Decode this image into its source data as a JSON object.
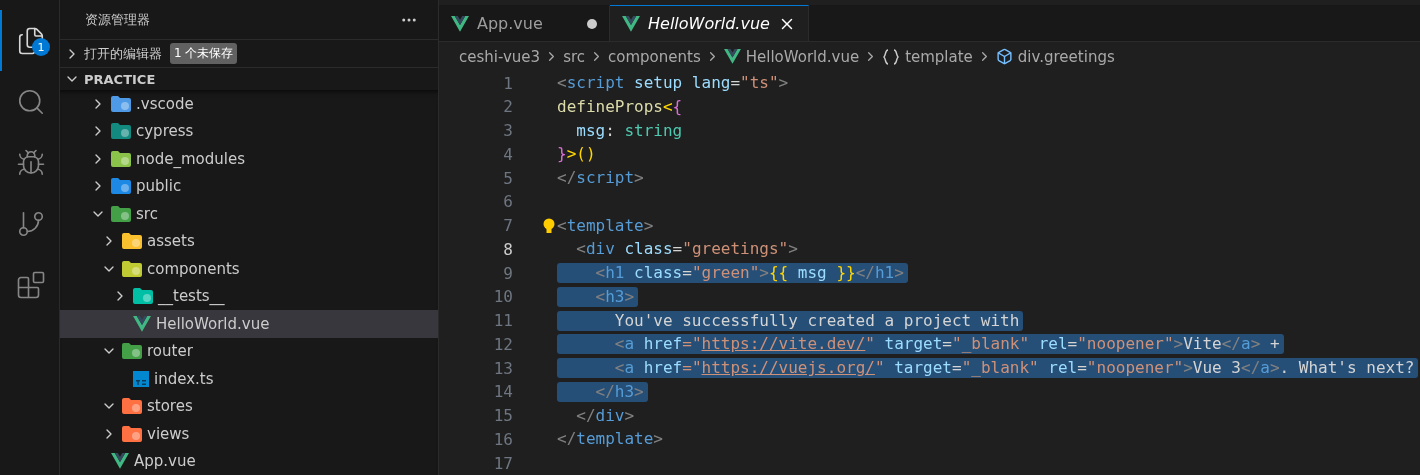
{
  "activity_bar": [
    {
      "kind": "files",
      "selected": true,
      "badge": "1"
    },
    {
      "kind": "search",
      "selected": false
    },
    {
      "kind": "debug",
      "selected": false
    },
    {
      "kind": "git",
      "selected": false
    },
    {
      "kind": "extensions",
      "selected": false
    }
  ],
  "sidebar": {
    "title": "资源管理器",
    "open_editors": {
      "label": "打开的编辑器",
      "expanded": false,
      "badge": "1 个未保存"
    },
    "project": {
      "label": "PRACTICE",
      "expanded": true,
      "tree": [
        {
          "label": ".vscode",
          "kind": "folder",
          "color": "#4f9ae6",
          "expanded": false
        },
        {
          "label": "cypress",
          "kind": "folder",
          "color": "#138a80",
          "expanded": false
        },
        {
          "label": "node_modules",
          "kind": "folder",
          "color": "#8bc34a",
          "expanded": false
        },
        {
          "label": "public",
          "kind": "folder",
          "color": "#1e88e5",
          "expanded": false
        },
        {
          "label": "src",
          "kind": "folder",
          "color": "#43a047",
          "expanded": true,
          "children": [
            {
              "label": "assets",
              "kind": "folder",
              "color": "#fbc02d",
              "expanded": false
            },
            {
              "label": "components",
              "kind": "folder",
              "color": "#c0ca33",
              "expanded": true,
              "children": [
                {
                  "label": "__tests__",
                  "kind": "folder",
                  "color": "#00bfa5",
                  "expanded": false
                },
                {
                  "label": "HelloWorld.vue",
                  "kind": "vue",
                  "selected": true
                }
              ]
            },
            {
              "label": "router",
              "kind": "folder",
              "color": "#43a047",
              "expanded": true,
              "children": [
                {
                  "label": "index.ts",
                  "kind": "ts",
                  "selected": false
                }
              ]
            },
            {
              "label": "stores",
              "kind": "folder",
              "color": "#ff7043",
              "expanded": true
            },
            {
              "label": "views",
              "kind": "folder",
              "color": "#ff7043",
              "expanded": false
            }
          ]
        },
        {
          "label": "App.vue",
          "kind": "vue",
          "selected": false
        }
      ]
    }
  },
  "tabs": [
    {
      "label": "App.vue",
      "selected": false,
      "modified": true
    },
    {
      "label": "HelloWorld.vue",
      "selected": true,
      "modified": false
    }
  ],
  "breadcrumbs": [
    {
      "label": "ceshi-vue3",
      "kind": "text"
    },
    {
      "label": "src",
      "kind": "text"
    },
    {
      "label": "components",
      "kind": "text"
    },
    {
      "label": "HelloWorld.vue",
      "kind": "vue"
    },
    {
      "label": "template",
      "kind": "braces"
    },
    {
      "label": "div.greetings",
      "kind": "element"
    }
  ],
  "code": [
    {
      "number": "1",
      "selected": false,
      "current": false,
      "tokens": [
        {
          "t": "<",
          "kind": "p"
        },
        {
          "t": "script",
          "kind": "tag"
        },
        {
          "t": " setup lang",
          "kind": "attr"
        },
        {
          "t": "=",
          "kind": "text"
        },
        {
          "t": "\"ts\"",
          "kind": "str"
        },
        {
          "t": ">",
          "kind": "p"
        }
      ]
    },
    {
      "number": "2",
      "selected": false,
      "current": false,
      "tokens": [
        {
          "t": "defineProps",
          "kind": "fn"
        },
        {
          "t": "<",
          "kind": "y"
        },
        {
          "t": "{",
          "kind": "m"
        }
      ]
    },
    {
      "number": "3",
      "selected": false,
      "current": false,
      "tokens": [
        {
          "t": "  msg",
          "kind": "attr"
        },
        {
          "t": ": ",
          "kind": "text"
        },
        {
          "t": "string",
          "kind": "type"
        }
      ]
    },
    {
      "number": "4",
      "selected": false,
      "current": false,
      "tokens": [
        {
          "t": "}",
          "kind": "m"
        },
        {
          "t": ">()",
          "kind": "y"
        }
      ]
    },
    {
      "number": "5",
      "selected": false,
      "current": false,
      "tokens": [
        {
          "t": "</",
          "kind": "p"
        },
        {
          "t": "script",
          "kind": "tag"
        },
        {
          "t": ">",
          "kind": "p"
        }
      ]
    },
    {
      "number": "6",
      "selected": false,
      "current": false
    },
    {
      "number": "7",
      "selected": false,
      "current": false,
      "lightbulb": true,
      "tokens": [
        {
          "t": "<",
          "kind": "p"
        },
        {
          "t": "template",
          "kind": "tag"
        },
        {
          "t": ">",
          "kind": "p"
        }
      ]
    },
    {
      "number": "8",
      "selected": false,
      "current": true,
      "tokens": [
        {
          "t": "  <",
          "kind": "p"
        },
        {
          "t": "div",
          "kind": "tag"
        },
        {
          "t": " class",
          "kind": "attr"
        },
        {
          "t": "=",
          "kind": "text"
        },
        {
          "t": "\"greetings\"",
          "kind": "str"
        },
        {
          "t": ">",
          "kind": "p"
        }
      ]
    },
    {
      "number": "9",
      "selected": true,
      "current": false,
      "tokens": [
        {
          "t": "    <",
          "kind": "p"
        },
        {
          "t": "h1",
          "kind": "tag"
        },
        {
          "t": " class",
          "kind": "attr"
        },
        {
          "t": "=",
          "kind": "text"
        },
        {
          "t": "\"green\"",
          "kind": "str"
        },
        {
          "t": ">",
          "kind": "p"
        },
        {
          "t": "{{",
          "kind": "y"
        },
        {
          "t": " msg ",
          "kind": "attr"
        },
        {
          "t": "}}",
          "kind": "y"
        },
        {
          "t": "</",
          "kind": "p"
        },
        {
          "t": "h1",
          "kind": "tag"
        },
        {
          "t": ">",
          "kind": "p"
        }
      ]
    },
    {
      "number": "10",
      "selected": true,
      "current": false,
      "tokens": [
        {
          "t": "    <",
          "kind": "p"
        },
        {
          "t": "h3",
          "kind": "tag"
        },
        {
          "t": ">",
          "kind": "p"
        }
      ]
    },
    {
      "number": "11",
      "selected": true,
      "current": false,
      "tokens": [
        {
          "t": "      You've successfully created a project with",
          "kind": "text"
        }
      ]
    },
    {
      "number": "12",
      "selected": true,
      "current": false,
      "tokens": [
        {
          "t": "      <",
          "kind": "p"
        },
        {
          "t": "a",
          "kind": "tag"
        },
        {
          "t": " href",
          "kind": "attr"
        },
        {
          "t": "=\"",
          "kind": "str"
        },
        {
          "t": "https://vite.dev/",
          "kind": "link"
        },
        {
          "t": "\"",
          "kind": "str"
        },
        {
          "t": " target",
          "kind": "attr"
        },
        {
          "t": "=",
          "kind": "text"
        },
        {
          "t": "\"_blank\"",
          "kind": "str"
        },
        {
          "t": " rel",
          "kind": "attr"
        },
        {
          "t": "=",
          "kind": "text"
        },
        {
          "t": "\"noopener\"",
          "kind": "str"
        },
        {
          "t": ">",
          "kind": "p"
        },
        {
          "t": "Vite",
          "kind": "text"
        },
        {
          "t": "</",
          "kind": "p"
        },
        {
          "t": "a",
          "kind": "tag"
        },
        {
          "t": ">",
          "kind": "p"
        },
        {
          "t": " +",
          "kind": "text"
        }
      ]
    },
    {
      "number": "13",
      "selected": true,
      "current": false,
      "tokens": [
        {
          "t": "      <",
          "kind": "p"
        },
        {
          "t": "a",
          "kind": "tag"
        },
        {
          "t": " href",
          "kind": "attr"
        },
        {
          "t": "=\"",
          "kind": "str"
        },
        {
          "t": "https://vuejs.org/",
          "kind": "link"
        },
        {
          "t": "\"",
          "kind": "str"
        },
        {
          "t": " target",
          "kind": "attr"
        },
        {
          "t": "=",
          "kind": "text"
        },
        {
          "t": "\"_blank\"",
          "kind": "str"
        },
        {
          "t": " rel",
          "kind": "attr"
        },
        {
          "t": "=",
          "kind": "text"
        },
        {
          "t": "\"noopener\"",
          "kind": "str"
        },
        {
          "t": ">",
          "kind": "p"
        },
        {
          "t": "Vue 3",
          "kind": "text"
        },
        {
          "t": "</",
          "kind": "p"
        },
        {
          "t": "a",
          "kind": "tag"
        },
        {
          "t": ">",
          "kind": "p"
        },
        {
          "t": ". What's next?",
          "kind": "text"
        }
      ]
    },
    {
      "number": "14",
      "selected": true,
      "current": false,
      "tokens": [
        {
          "t": "    </",
          "kind": "p"
        },
        {
          "t": "h3",
          "kind": "tag"
        },
        {
          "t": ">",
          "kind": "p"
        }
      ]
    },
    {
      "number": "15",
      "selected": false,
      "current": false,
      "tokens": [
        {
          "t": "  </",
          "kind": "p"
        },
        {
          "t": "div",
          "kind": "tag"
        },
        {
          "t": ">",
          "kind": "p"
        }
      ]
    },
    {
      "number": "16",
      "selected": false,
      "current": false,
      "tokens": [
        {
          "t": "</",
          "kind": "p"
        },
        {
          "t": "template",
          "kind": "tag"
        },
        {
          "t": ">",
          "kind": "p"
        }
      ]
    },
    {
      "number": "17",
      "selected": false,
      "current": false
    }
  ]
}
